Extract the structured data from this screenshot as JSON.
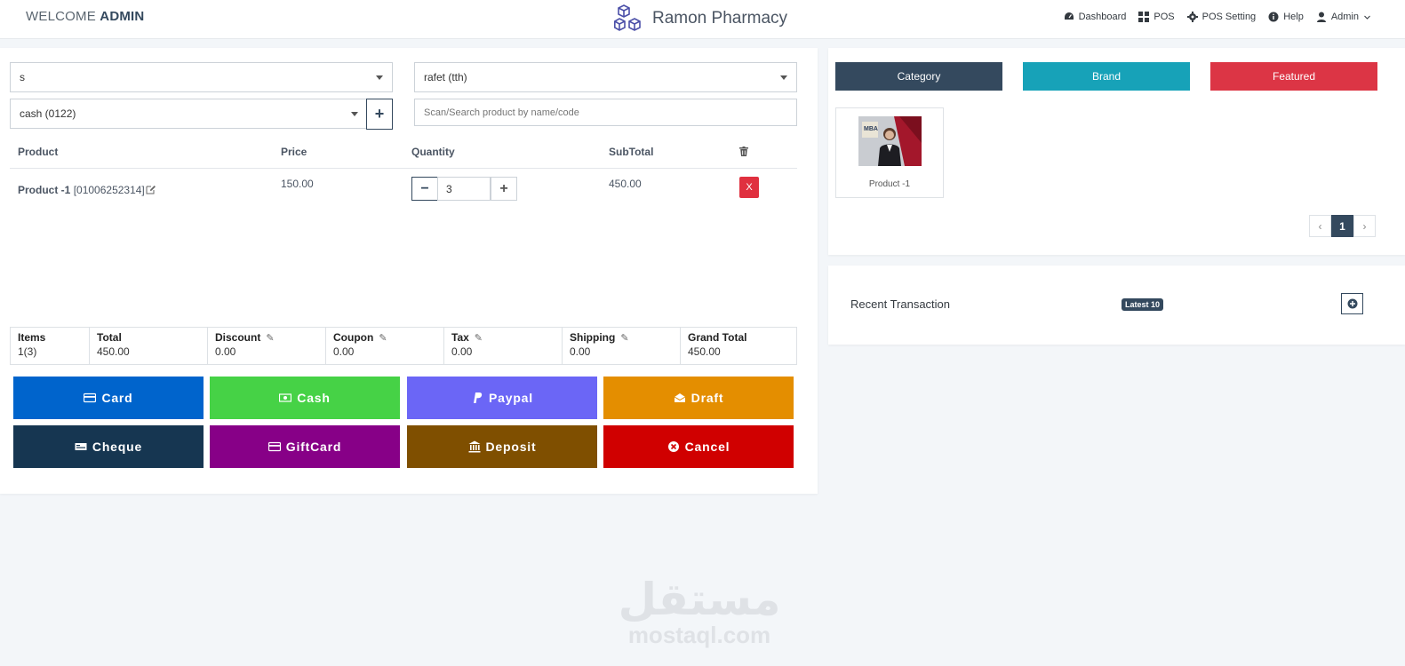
{
  "header": {
    "welcome_prefix": "WELCOME",
    "welcome_user": "ADMIN",
    "app_name": "Ramon Pharmacy",
    "nav": [
      {
        "label": "Dashboard",
        "icon": "dashboard-icon"
      },
      {
        "label": "POS",
        "icon": "grid-icon"
      },
      {
        "label": "POS Setting",
        "icon": "gear-icon"
      },
      {
        "label": "Help",
        "icon": "info-icon"
      },
      {
        "label": "Admin",
        "icon": "user-icon"
      }
    ]
  },
  "form": {
    "warehouse_value": "s",
    "customer_value": "rafet (tth)",
    "payment_account_value": "cash (0122)",
    "search_placeholder": "Scan/Search product by name/code"
  },
  "table": {
    "headers": {
      "product": "Product",
      "price": "Price",
      "quantity": "Quantity",
      "subtotal": "SubTotal"
    },
    "rows": [
      {
        "name": "Product -1",
        "code": "[01006252314]",
        "price": "150.00",
        "quantity": "3",
        "subtotal": "450.00",
        "remove_label": "X"
      }
    ]
  },
  "summary": {
    "items_label": "Items",
    "items_value": "1(3)",
    "total_label": "Total",
    "total_value": "450.00",
    "discount_label": "Discount",
    "discount_value": "0.00",
    "coupon_label": "Coupon",
    "coupon_value": "0.00",
    "tax_label": "Tax",
    "tax_value": "0.00",
    "shipping_label": "Shipping",
    "shipping_value": "0.00",
    "grand_total_label": "Grand Total",
    "grand_total_value": "450.00"
  },
  "payments": {
    "card": "Card",
    "cash": "Cash",
    "paypal": "Paypal",
    "draft": "Draft",
    "cheque": "Cheque",
    "giftcard": "GiftCard",
    "deposit": "Deposit",
    "cancel": "Cancel"
  },
  "colors": {
    "card": "#0064cc",
    "cash": "#46d246",
    "paypal": "#6b66f6",
    "draft": "#e48e00",
    "cheque": "#163651",
    "giftcard": "#870087",
    "deposit": "#7f4f00",
    "cancel": "#d00000",
    "category_tab": "#34495e",
    "brand_tab": "#17a2b8",
    "featured_tab": "#dc3545"
  },
  "tabs": {
    "category": "Category",
    "brand": "Brand",
    "featured": "Featured"
  },
  "products": [
    {
      "name": "Product -1",
      "image_text": "MBA"
    }
  ],
  "pagination": {
    "prev": "‹",
    "current": "1",
    "next": "›"
  },
  "recent": {
    "title": "Recent Transaction",
    "badge": "Latest 10"
  },
  "watermark": {
    "arabic": "مستقل",
    "latin": "mostaql.com"
  }
}
